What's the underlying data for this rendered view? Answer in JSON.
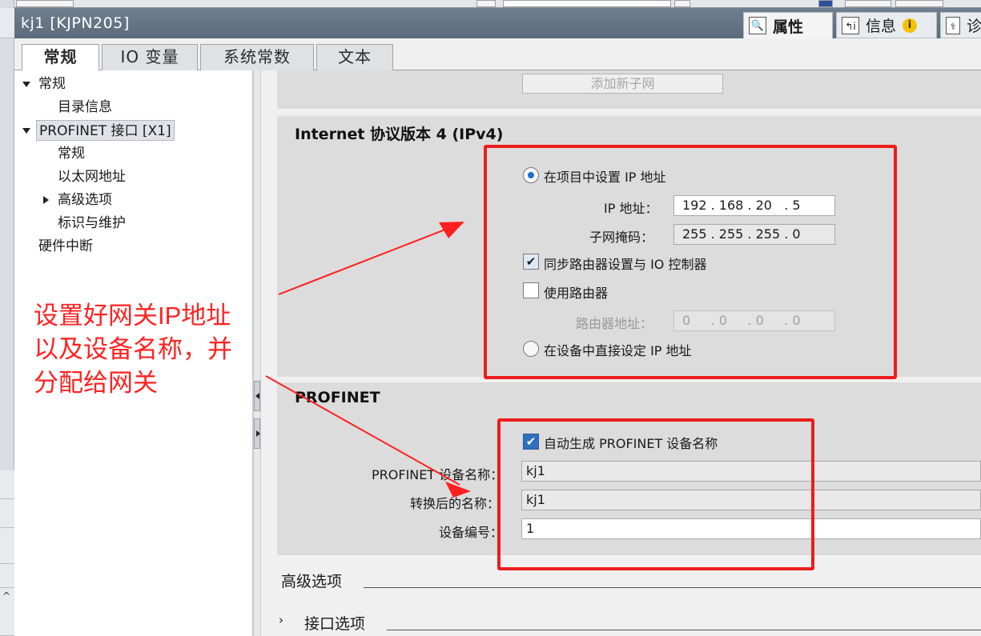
{
  "window": {
    "title": "kj1 [KJPN205]"
  },
  "panel_tabs": {
    "properties": "属性",
    "info": "信息",
    "diagnostics": "诊"
  },
  "tabs": [
    "常规",
    "IO 变量",
    "系统常数",
    "文本"
  ],
  "nav": {
    "items": [
      "常规",
      "目录信息",
      "PROFINET 接口 [X1]",
      "常规",
      "以太网地址",
      "高级选项",
      "标识与维护",
      "硬件中断"
    ]
  },
  "annotation": {
    "lines": [
      "设置好网关IP地址",
      "以及设备名称，并",
      "分配给网关"
    ]
  },
  "subnet": {
    "add_button": "添加新子网"
  },
  "ipv4": {
    "title": "Internet 协议版本 4 (IPv4)",
    "set_in_project": "在项目中设置 IP 地址",
    "ip_label": "IP 地址：",
    "ip_value": "192 . 168 . 20   . 5",
    "mask_label": "子网掩码：",
    "mask_value": "255 . 255 . 255 . 0",
    "sync_router": "同步路由器设置与 IO 控制器",
    "use_router": "使用路由器",
    "router_label": "路由器地址：",
    "router_value": "0     . 0     . 0     . 0",
    "set_on_device": "在设备中直接设定 IP 地址"
  },
  "profinet": {
    "title": "PROFINET",
    "auto_name": "自动生成 PROFINET 设备名称",
    "device_name_label": "PROFINET 设备名称：",
    "device_name_value": "kj1",
    "converted_name_label": "转换后的名称：",
    "converted_name_value": "kj1",
    "device_number_label": "设备编号：",
    "device_number_value": "1"
  },
  "sections": {
    "advanced": "高级选项",
    "interface": "接口选项"
  },
  "colors": {
    "annotation": "#ff2222",
    "titlebar": "#64748a",
    "radio_selected": "#1e6fd0"
  }
}
